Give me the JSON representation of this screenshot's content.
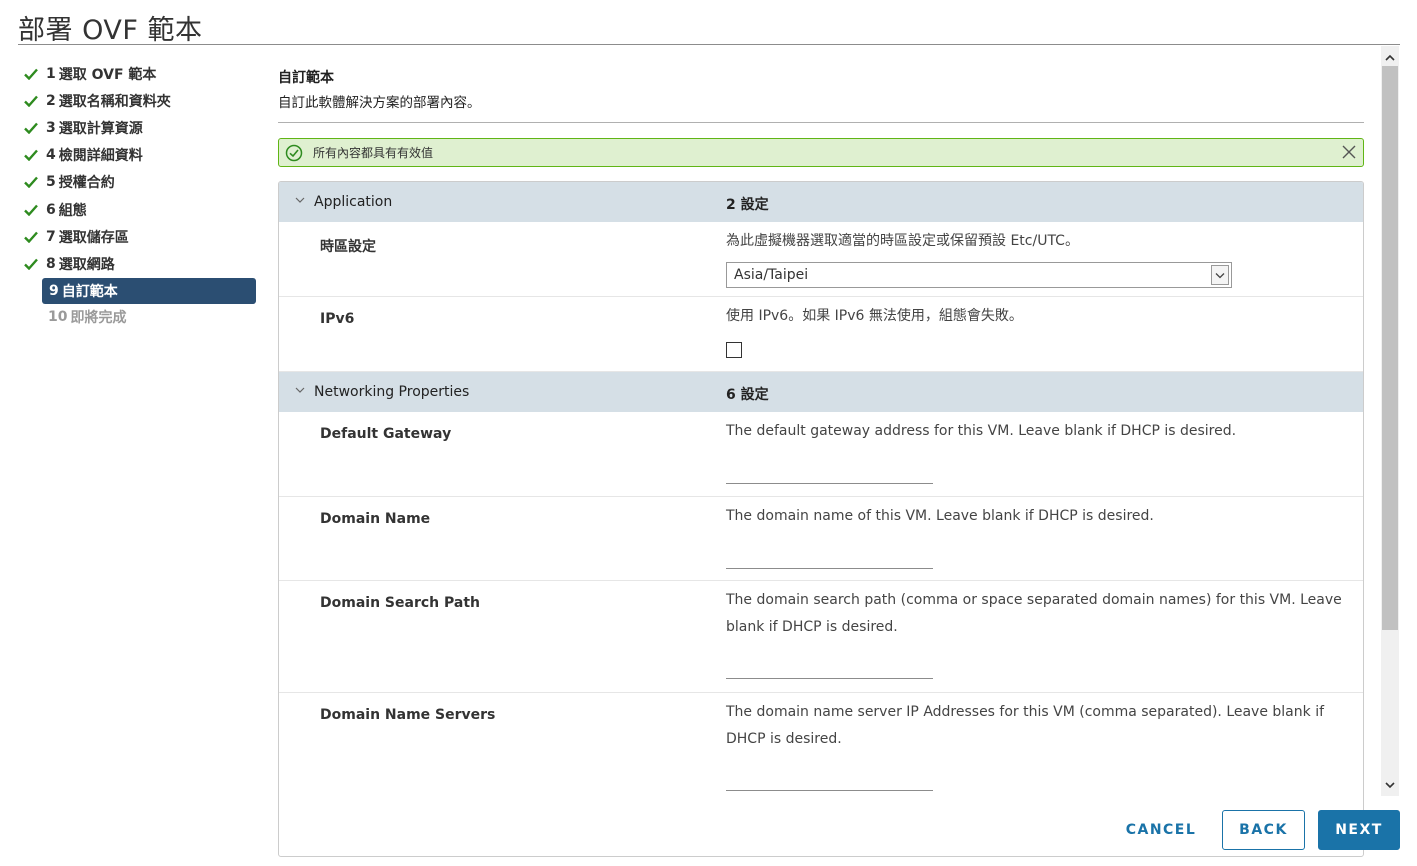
{
  "window": {
    "title": "部署 OVF 範本"
  },
  "steps": [
    {
      "num": "1",
      "label": "選取 OVF 範本",
      "state": "done"
    },
    {
      "num": "2",
      "label": "選取名稱和資料夾",
      "state": "done"
    },
    {
      "num": "3",
      "label": "選取計算資源",
      "state": "done"
    },
    {
      "num": "4",
      "label": "檢閱詳細資料",
      "state": "done"
    },
    {
      "num": "5",
      "label": "授權合約",
      "state": "done"
    },
    {
      "num": "6",
      "label": "組態",
      "state": "done"
    },
    {
      "num": "7",
      "label": "選取儲存區",
      "state": "done"
    },
    {
      "num": "8",
      "label": "選取網路",
      "state": "done"
    },
    {
      "num": "9",
      "label": "自訂範本",
      "state": "active"
    },
    {
      "num": "10",
      "label": "即將完成",
      "state": "disabled"
    }
  ],
  "main": {
    "title": "自訂範本",
    "subtitle": "自訂此軟體解決方案的部署內容。"
  },
  "alert": {
    "text": "所有內容都具有有效值"
  },
  "groups": {
    "application": {
      "name": "Application",
      "count": "2 設定",
      "timezone": {
        "label": "時區設定",
        "desc": "為此虛擬機器選取適當的時區設定或保留預設 Etc/UTC。",
        "selected": "Asia/Taipei"
      },
      "ipv6": {
        "label": "IPv6",
        "desc": "使用 IPv6。如果 IPv6 無法使用，組態會失敗。",
        "checked": false
      }
    },
    "networking": {
      "name": "Networking Properties",
      "count": "6 設定",
      "gateway": {
        "label": "Default Gateway",
        "desc": "The default gateway address for this VM. Leave blank if DHCP is desired.",
        "value": ""
      },
      "domain_name": {
        "label": "Domain Name",
        "desc": "The domain name of this VM. Leave blank if DHCP is desired.",
        "value": ""
      },
      "search_path": {
        "label": "Domain Search Path",
        "desc": "The domain search path (comma or space separated domain names) for this VM. Leave blank if DHCP is desired.",
        "value": ""
      },
      "name_servers": {
        "label": "Domain Name Servers",
        "desc": "The domain name server IP Addresses for this VM (comma separated). Leave blank if DHCP is desired.",
        "value": ""
      }
    }
  },
  "footer": {
    "cancel": "CANCEL",
    "back": "BACK",
    "next": "NEXT"
  },
  "colors": {
    "accent": "#1a73a8",
    "active_step": "#2b4e72",
    "success_bg": "#dff0d0",
    "success_border": "#60b515",
    "check": "#2e8b1f",
    "group_header": "#d5dfe6"
  }
}
